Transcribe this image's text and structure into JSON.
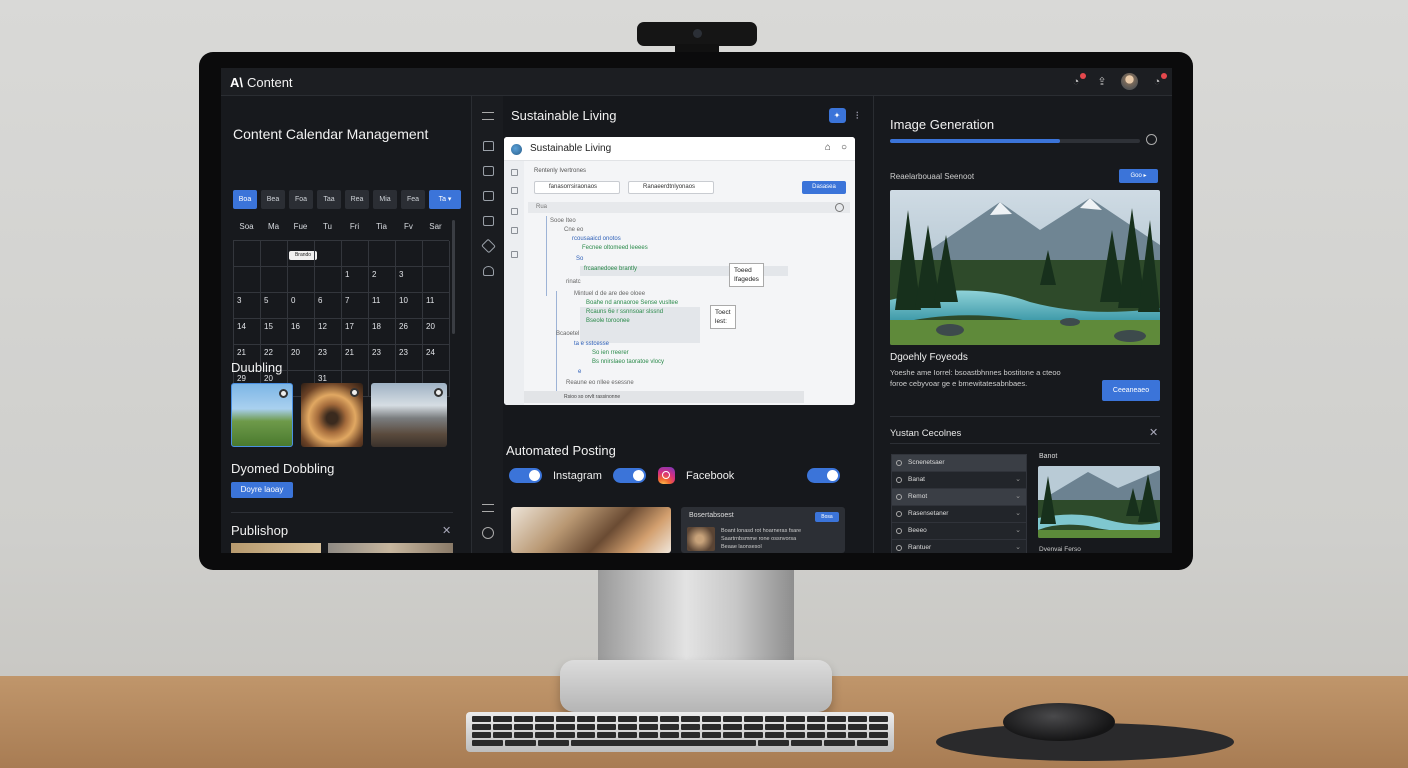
{
  "app": {
    "logo": "A\\",
    "title": "Content"
  },
  "left": {
    "title": "Content Calendar Management",
    "tabs": [
      "Boa",
      "Bea",
      "Foa",
      "Taa",
      "Rea",
      "Mia",
      "Fea",
      "Ta ▾"
    ],
    "days": [
      "Soa",
      "Ma",
      "Fue",
      "Tu",
      "Fri",
      "Tia",
      "Fv",
      "Sar"
    ],
    "weeks": [
      [
        "",
        "",
        "",
        "",
        "",
        "",
        "",
        ""
      ],
      [
        "",
        "",
        "",
        "",
        "1",
        "2",
        "3",
        ""
      ],
      [
        "3",
        "5",
        "0",
        "6",
        "7",
        "11",
        "10",
        "11"
      ],
      [
        "14",
        "15",
        "16",
        "12",
        "17",
        "18",
        "26",
        "20"
      ],
      [
        "21",
        "22",
        "20",
        "23",
        "21",
        "23",
        "23",
        "24"
      ],
      [
        "29",
        "20",
        "",
        "31",
        "",
        "",
        "",
        ""
      ]
    ],
    "event_label": "Brando",
    "dubbing_title": "Duubling",
    "dyomed_title": "Dyomed Dobbling",
    "dyomed_button": "Doyre laoay",
    "publish_title": "Publishop",
    "close": "✕"
  },
  "mid": {
    "title": "Sustainable Living",
    "doc_title": "Sustainable Living",
    "doc": {
      "header_line": "Rentenly Ivertrones",
      "search1": "fanasorrsiraonaos",
      "search2": "Ranaeerdtnlyonaos",
      "button": "Dasasea",
      "sort_label": "Rua",
      "lines": [
        "Sooe Iteo",
        "Cne eo",
        "rcousaaicd onotos",
        "Fecnee oltomeed leeees",
        "So",
        "frcaanedoee brantly",
        "rinatc",
        "Mintuel d de are dee oloee",
        "Boahe nd annaoroe Sense vusltee",
        "Rcauns 6e r ssnnsoar slssnd",
        "Bseole toroonee",
        "Bcaoetel",
        "ta e sstcesse",
        "So ien rreerer",
        "Bs nnirslaeo taoratoe vlocy",
        "e",
        "Reaune eo nllee esessne"
      ],
      "tip1_a": "Toeed",
      "tip1_b": "Ifagedes",
      "tip2_a": "Toect",
      "tip2_b": "lest:",
      "footer": "Rsioo so orvlt rassinonne"
    },
    "auto_title": "Automated Posting",
    "instagram": "Instagram",
    "facebook": "Facebook",
    "post_card": {
      "title": "Bosertabsoest",
      "button": "Bosa",
      "line1": "Boant lonasd rot hoarneras fsare",
      "line2": "Saartrnbsmme rone ossnvorsa",
      "line3": "Beaae laonsesol"
    }
  },
  "right": {
    "title": "Image Generation",
    "progress": 0.68,
    "sub": "Reaelarbouaal Seenoot",
    "chip": "Goo ▸",
    "cap_title": "Dgoehly Foyeods",
    "cap_line1": "Yoeshe ame Iorrel: bsoastbhnnes bostitone a cteoo",
    "cap_line2": "foroe cebyvoar ge e bmewitatesabnbaes.",
    "button": "Ceeaneaeo",
    "section": "Yustan Cecolnes",
    "close": "✕",
    "list": [
      "Scnenetsaer",
      "Banat",
      "Remot",
      "Rasensetaner",
      "Beeeo",
      "Rantuer"
    ],
    "preview_label": "Banot",
    "preview_caption": "Dvenvai Ferso"
  },
  "colors": {
    "accent": "#3b74d9",
    "bg": "#16181c",
    "panel": "#1c1e22"
  }
}
